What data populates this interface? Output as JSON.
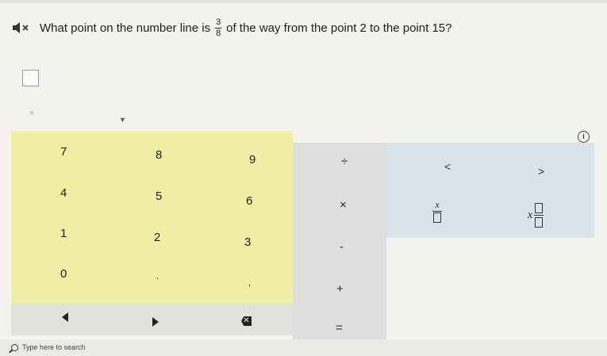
{
  "question": {
    "text_before": "What point on the number line is",
    "fraction_numerator": "3",
    "fraction_denominator": "8",
    "text_after": "of the way from the point 2 to the point 15?"
  },
  "answer": {
    "equals_mark": "="
  },
  "info_label": "i",
  "numpad": {
    "keys": [
      "7",
      "8",
      "9",
      "4",
      "5",
      "6",
      "1",
      "2",
      "3",
      "0",
      ".",
      ","
    ]
  },
  "operators": {
    "divide": "÷",
    "multiply": "×",
    "minus": "-",
    "plus": "+",
    "equals": "="
  },
  "symbols": {
    "less_than": "<",
    "greater_than": ">",
    "variable": "x"
  },
  "taskbar": {
    "search_placeholder": "Type here to search"
  },
  "colors": {
    "numpad_bg": "#f1eea6",
    "operators_bg": "#dedede",
    "symbols_bg": "#d9e4ea",
    "page_bg": "#f3f2ee"
  }
}
